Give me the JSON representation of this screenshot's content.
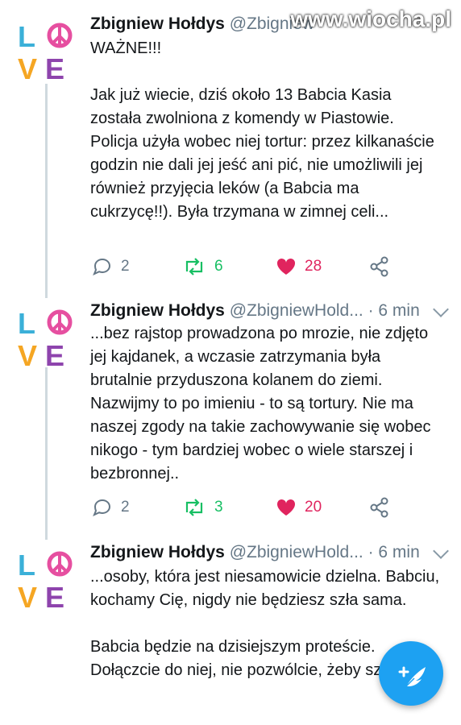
{
  "watermark": "www.wiocha.pl",
  "colors": {
    "accent": "#1da1f2",
    "retweet": "#17bf63",
    "like": "#e0245e",
    "muted": "#657786"
  },
  "tweets": [
    {
      "name": "Zbigniew Hołdys",
      "handle": "@Zbigniew",
      "time": "",
      "text": "WAŻNE!!!\n\nJak już wiecie, dziś około 13 Babcia Kasia została zwolniona z komendy w Piastowie. Policja użyła wobec niej tortur: przez kilkanaście godzin nie dali jej jeść ani pić, nie umożliwili jej również przyjęcia leków (a Babcia ma cukrzycę!!). Była trzymana w zimnej celi...",
      "replies": "2",
      "retweets": "6",
      "likes": "28"
    },
    {
      "name": "Zbigniew Hołdys",
      "handle": "@ZbigniewHold...",
      "time": "· 6 min",
      "text": "...bez rajstop prowadzona po mrozie, nie zdjęto jej kajdanek, a wczasie zatrzymania była brutalnie przyduszona kolanem do ziemi. Nazwijmy to po imieniu - to są tortury. Nie ma naszej zgody na takie zachowywanie się wobec nikogo - tym bardziej wobec o wiele starszej i bezbronnej..",
      "replies": "2",
      "retweets": "3",
      "likes": "20"
    },
    {
      "name": "Zbigniew Hołdys",
      "handle": "@ZbigniewHold...",
      "time": "· 6 min",
      "text": "...osoby, która jest niesamowicie dzielna. Babciu, kochamy Cię, nigdy nie będziesz szła sama.\n\nBabcia będzie na dzisiejszym proteście. Dołączcie do niej, nie pozwólcie, żeby szła sama."
    }
  ]
}
